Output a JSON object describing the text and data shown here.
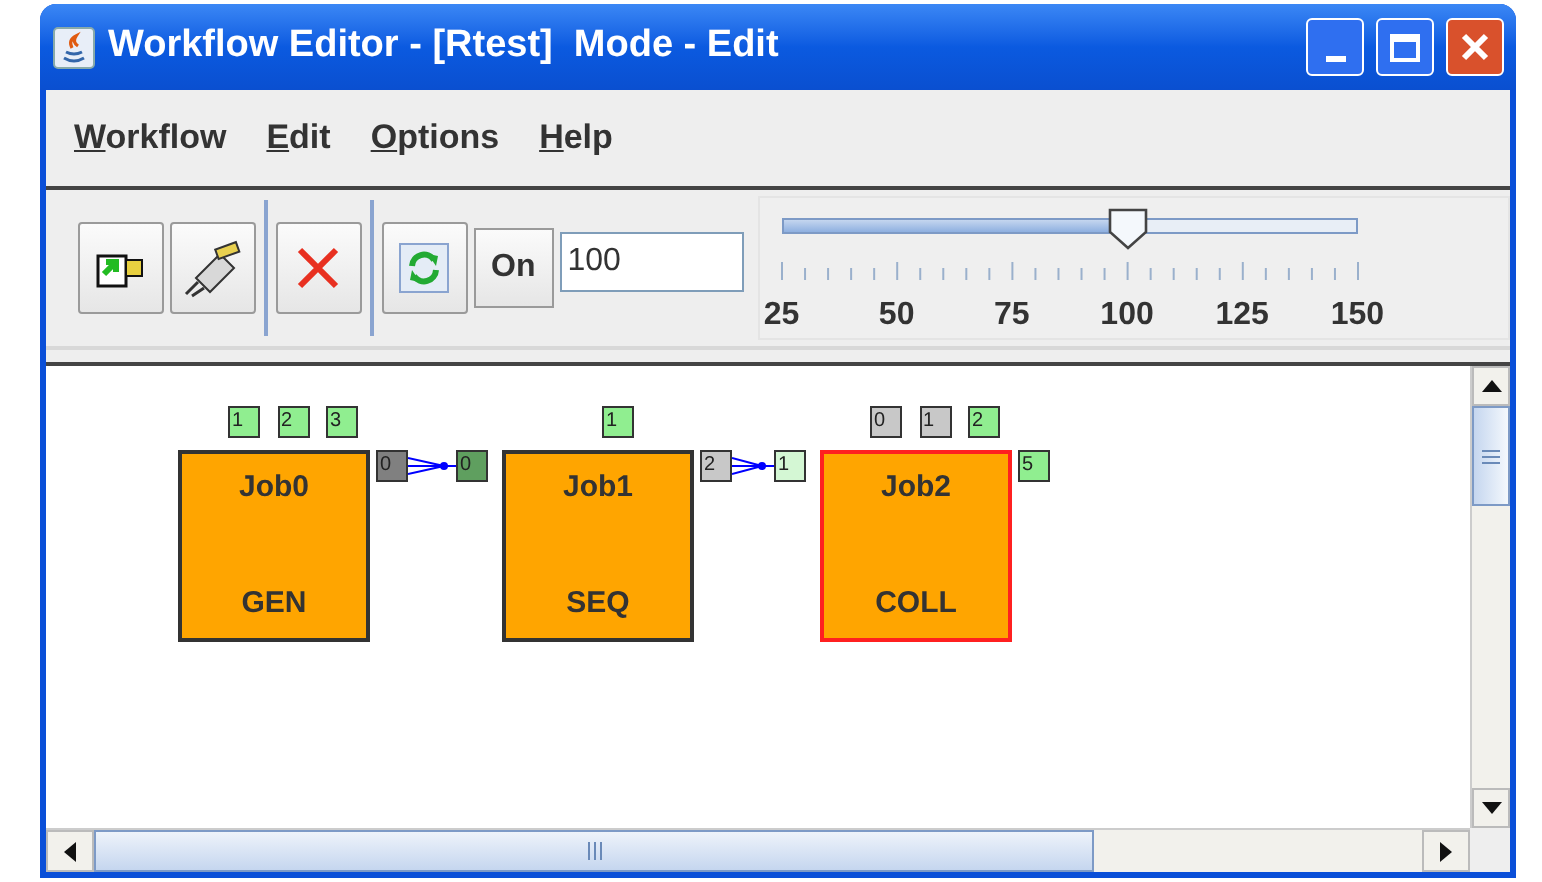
{
  "window": {
    "title": "Workflow Editor - [Rtest]  Mode - Edit"
  },
  "menu": [
    "Workflow",
    "Edit",
    "Options",
    "Help"
  ],
  "toolbar": {
    "toggle_label": "On",
    "zoom_value": "100",
    "slider": {
      "level": 0.6,
      "labels": [
        "25",
        "50",
        "75",
        "100",
        "125",
        "150"
      ]
    }
  },
  "jobs": [
    {
      "name": "Job0",
      "type": "GEN",
      "selected": false,
      "top_ports": [
        {
          "label": "1",
          "color": "#90ee90"
        },
        {
          "label": "2",
          "color": "#90ee90"
        },
        {
          "label": "3",
          "color": "#90ee90"
        }
      ],
      "right_port": {
        "label": "0",
        "color": "#808080"
      }
    },
    {
      "name": "Job1",
      "type": "SEQ",
      "selected": false,
      "left_port": {
        "label": "0",
        "color": "#5f9f5f"
      },
      "top_ports": [
        {
          "label": "1",
          "color": "#90ee90"
        }
      ],
      "right_port": {
        "label": "2",
        "color": "#c8c8c8"
      }
    },
    {
      "name": "Job2",
      "type": "COLL",
      "selected": true,
      "left_port": {
        "label": "1",
        "color": "#d4f7d4"
      },
      "top_ports": [
        {
          "label": "0",
          "color": "#c8c8c8"
        },
        {
          "label": "1",
          "color": "#c8c8c8"
        },
        {
          "label": "2",
          "color": "#90ee90"
        }
      ],
      "right_port": {
        "label": "5",
        "color": "#90ee90"
      }
    }
  ]
}
